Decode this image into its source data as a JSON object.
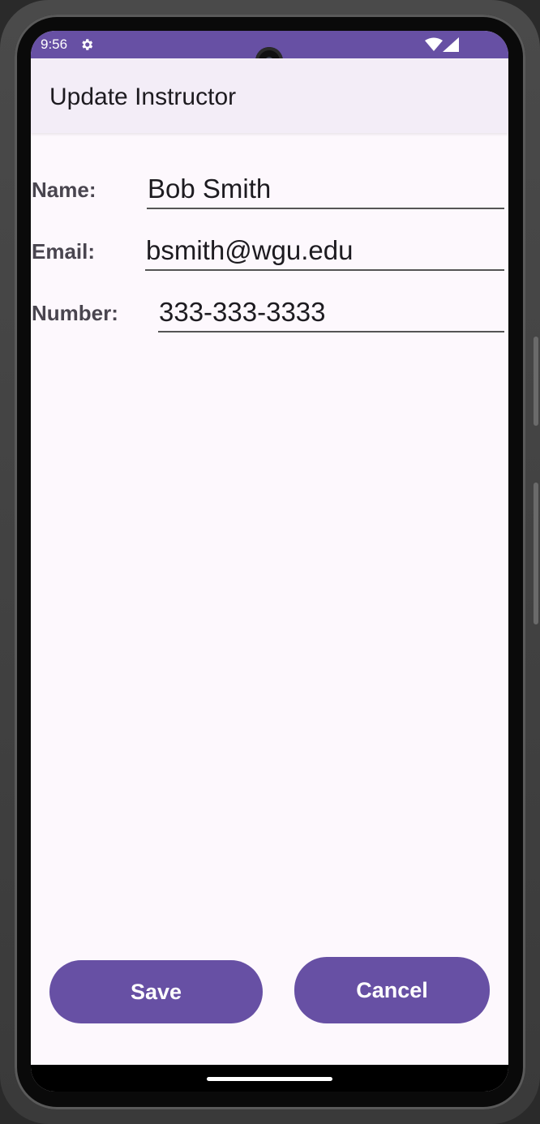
{
  "status_bar": {
    "time": "9:56",
    "settings_icon": "gear-icon",
    "wifi_icon": "wifi-icon",
    "signal_icon": "cell-signal-icon",
    "background_color": "#6750a4"
  },
  "app_bar": {
    "title": "Update Instructor"
  },
  "form": {
    "name": {
      "label": "Name:",
      "value": "Bob Smith"
    },
    "email": {
      "label": "Email:",
      "value": "bsmith@wgu.edu"
    },
    "number": {
      "label": "Number:",
      "value": "333-333-3333"
    }
  },
  "actions": {
    "save_label": "Save",
    "cancel_label": "Cancel"
  },
  "colors": {
    "primary": "#6750a4",
    "surface": "#fdf8fd",
    "app_bar": "#f3edf7"
  }
}
